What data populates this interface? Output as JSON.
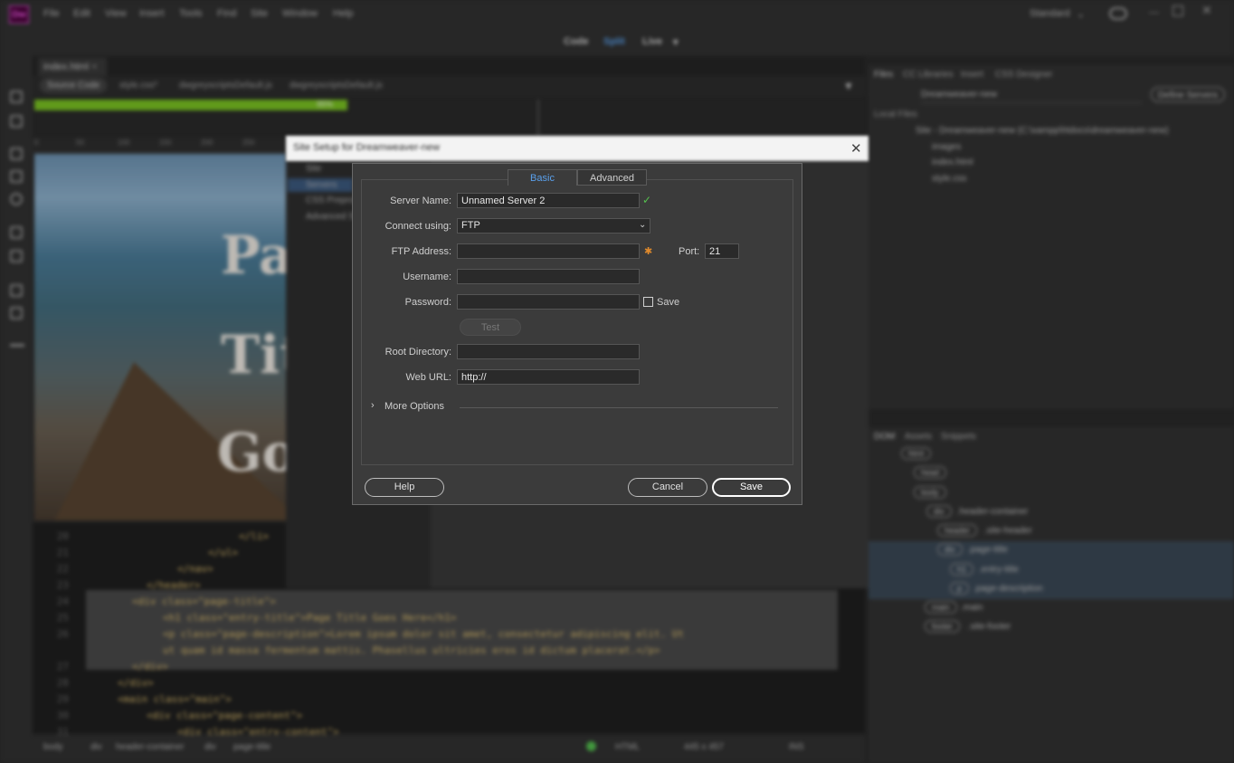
{
  "app": {
    "logo": "Dw",
    "menu": [
      "File",
      "Edit",
      "View",
      "Insert",
      "Tools",
      "Find",
      "Site",
      "Window",
      "Help"
    ],
    "workspace": "Standard",
    "views": [
      "Code",
      "Split",
      "Live"
    ]
  },
  "document": {
    "tab": "index.html",
    "source_chip": "Source Code",
    "related_files": [
      "style.css*",
      "dwgreyscriptsDefault.js",
      "dwgreyscriptsDefault.js"
    ],
    "progress_label": "95%",
    "ruler_ticks": [
      "0",
      "50",
      "100",
      "150",
      "200",
      "250"
    ],
    "hero_words": [
      "Pag",
      "Title",
      "Go"
    ],
    "code_lines": [
      {
        "n": "20",
        "text": "</li>"
      },
      {
        "n": "21",
        "text": "</ul>"
      },
      {
        "n": "22",
        "text": "</nav>"
      },
      {
        "n": "23",
        "text": "</header>"
      },
      {
        "n": "24",
        "text": "<div class=\"page-title\">"
      },
      {
        "n": "25",
        "text": "<h1 class=\"entry-title\">Page Title Goes Here</h1>"
      },
      {
        "n": "26",
        "text": "<p class=\"page-description\">Lorem ipsum dolor sit amet, consectetur adipiscing elit. Ut"
      },
      {
        "n": "",
        "text": "ut quam id massa fermentum mattis. Phasellus ultricies eros id dictum placerat.</p>"
      },
      {
        "n": "27",
        "text": "</div>"
      },
      {
        "n": "28",
        "text": "</div>"
      },
      {
        "n": "29",
        "text": "<main class=\"main\">"
      },
      {
        "n": "30",
        "text": "<div class=\"page-content\">"
      },
      {
        "n": "31",
        "text": "<div class=\"entry-content\">"
      }
    ],
    "status": {
      "crumbs": [
        "body",
        "div",
        "header-container",
        "div",
        "page-title"
      ],
      "language": "HTML",
      "size": "445 x 457",
      "mode": "INS"
    }
  },
  "files_panel": {
    "tabs": [
      "Files",
      "CC Libraries",
      "Insert",
      "CSS Designer"
    ],
    "site_select": "Dreamweaver-new",
    "define_servers": "Define Servers",
    "local_files": "Local Files",
    "site_root": "Site - Dreamweaver-new (C:\\xampp\\htdocs\\dreamweaver-new)",
    "files": [
      "images",
      "index.html",
      "style.css"
    ]
  },
  "dom_panel": {
    "tabs": [
      "DOM",
      "Assets",
      "Snippets"
    ],
    "nodes": [
      {
        "tag": "html",
        "label": ""
      },
      {
        "tag": "head",
        "label": ""
      },
      {
        "tag": "body",
        "label": ""
      },
      {
        "tag": "div",
        "label": ".header-container"
      },
      {
        "tag": "header",
        "label": ".site-header"
      },
      {
        "tag": "div",
        "label": ".page-title"
      },
      {
        "tag": "h1",
        "label": ".entry-title"
      },
      {
        "tag": "p",
        "label": ".page-description"
      },
      {
        "tag": "main",
        "label": ".main"
      },
      {
        "tag": "footer",
        "label": ".site-footer"
      }
    ]
  },
  "site_setup": {
    "title": "Site Setup for Dreamweaver-new",
    "nav": [
      "Site",
      "Servers",
      "CSS Preprocessors",
      "Advanced Settings"
    ],
    "selected_nav": "Servers"
  },
  "server_dialog": {
    "tabs": [
      "Basic",
      "Advanced"
    ],
    "active_tab": "Basic",
    "fields": {
      "server_name": {
        "label": "Server Name:",
        "value": "Unnamed Server 2"
      },
      "connect_using": {
        "label": "Connect using:",
        "value": "FTP"
      },
      "ftp_address": {
        "label": "FTP Address:",
        "value": ""
      },
      "port": {
        "label": "Port:",
        "value": "21"
      },
      "username": {
        "label": "Username:",
        "value": ""
      },
      "password": {
        "label": "Password:",
        "value": ""
      },
      "save_password": {
        "label": "Save",
        "checked": false
      },
      "root_directory": {
        "label": "Root Directory:",
        "value": ""
      },
      "web_url": {
        "label": "Web URL:",
        "value": "http://"
      }
    },
    "test_label": "Test",
    "more_options": "More Options",
    "buttons": {
      "help": "Help",
      "cancel": "Cancel",
      "save": "Save"
    },
    "colors": {
      "active_tab": "#5aa0ec",
      "valid_check": "#55c24f",
      "required": "#e08a2c"
    }
  }
}
